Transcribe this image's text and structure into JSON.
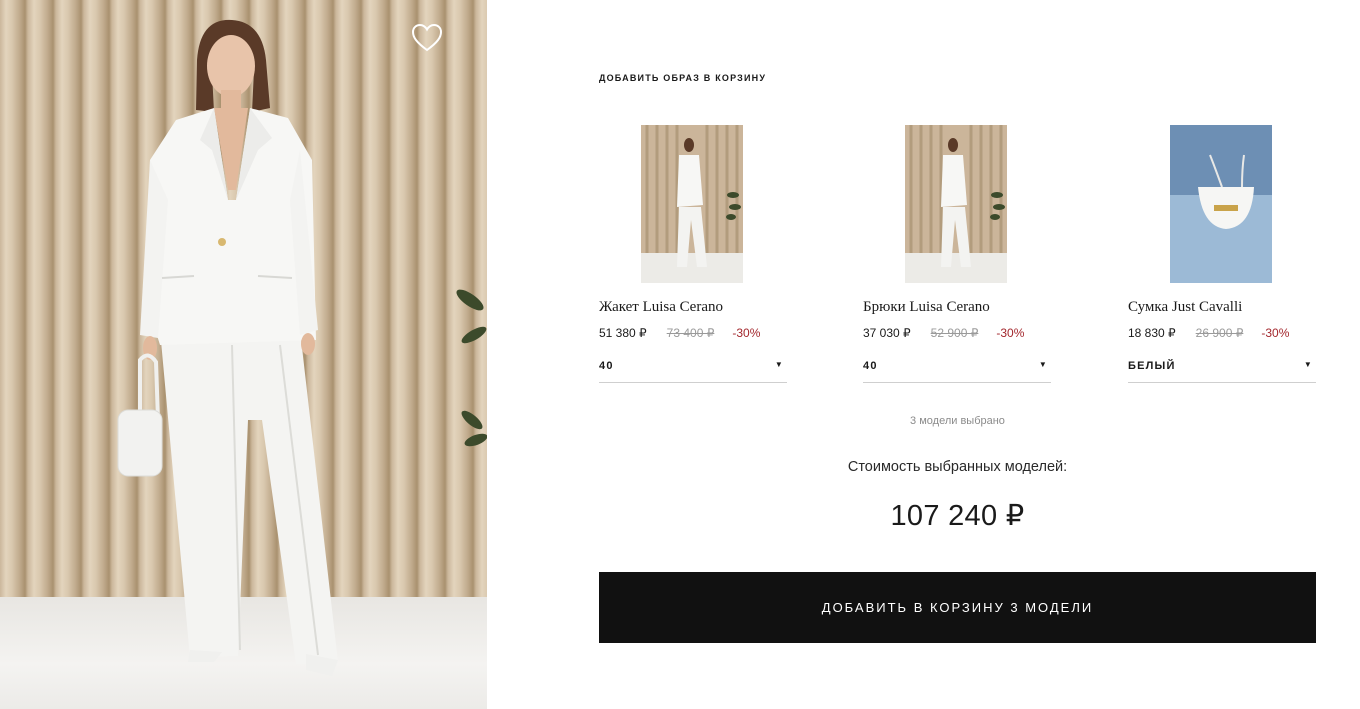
{
  "look": {
    "title": "ДОБАВИТЬ ОБРАЗ В КОРЗИНУ",
    "hero_image": "model-white-suit-photo",
    "favorite_icon": "heart-outline-icon"
  },
  "products": [
    {
      "name": "Жакет Luisa Cerano",
      "price": "51 380 ₽",
      "old_price": "73 400 ₽",
      "discount": "-30%",
      "option": "40",
      "thumbnail": "white-suit-thumbnail"
    },
    {
      "name": "Брюки Luisa Cerano",
      "price": "37 030 ₽",
      "old_price": "52 900 ₽",
      "discount": "-30%",
      "option": "40",
      "thumbnail": "white-suit-thumbnail"
    },
    {
      "name": "Сумка Just Cavalli",
      "price": "18 830 ₽",
      "old_price": "26 900 ₽",
      "discount": "-30%",
      "option": "БЕЛЫЙ",
      "thumbnail": "white-bag-thumbnail"
    }
  ],
  "summary": {
    "selected_count": "3 модели выбрано",
    "total_label": "Стоимость выбранных моделей:",
    "total_value": "107 240 ₽"
  },
  "cta": {
    "label": "ДОБАВИТЬ В КОРЗИНУ 3 МОДЕЛИ"
  },
  "colors": {
    "button": "#111111",
    "discount": "#a3272d",
    "old_price": "#9a9a9a"
  }
}
